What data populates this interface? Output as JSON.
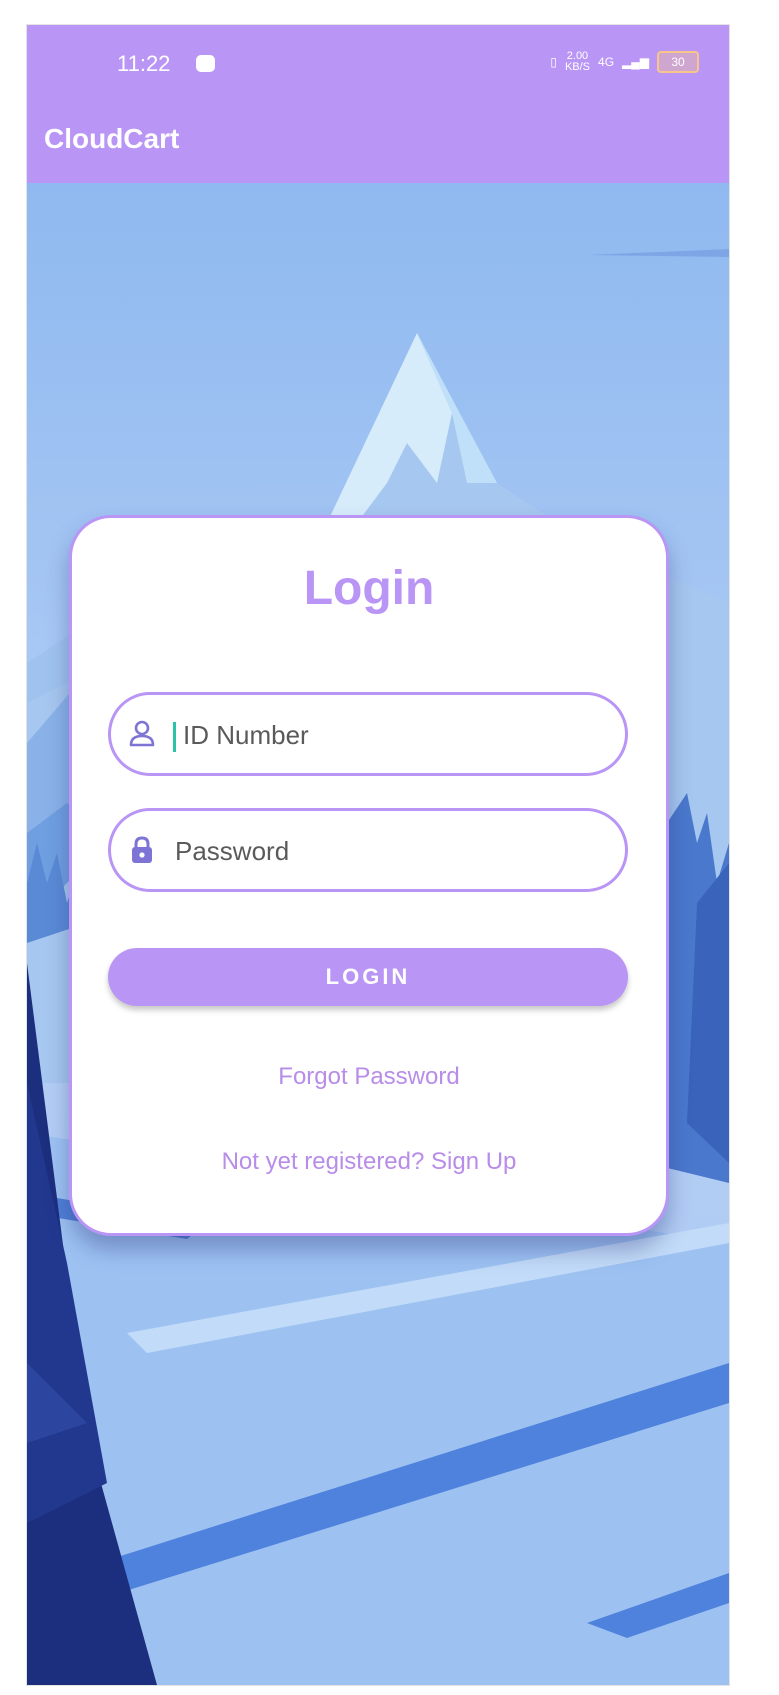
{
  "status_bar": {
    "time": "11:22",
    "speed": "2.00",
    "speed_unit": "KB/S",
    "network": "4G",
    "battery": "30"
  },
  "app_bar": {
    "title": "CloudCart"
  },
  "login_card": {
    "title": "Login",
    "id_field": {
      "placeholder": "ID Number",
      "value": "",
      "icon": "person-icon"
    },
    "password_field": {
      "placeholder": "Password",
      "value": "",
      "icon": "lock-icon"
    },
    "login_button": "LOGIN",
    "forgot_password": "Forgot Password",
    "signup_link": "Not yet registered? Sign Up"
  },
  "colors": {
    "accent": "#b995f5",
    "link": "#b88ce9",
    "cursor": "#2cc2a8",
    "background_sky": "#a9c9f2",
    "background_dark": "#1c2f7e"
  }
}
